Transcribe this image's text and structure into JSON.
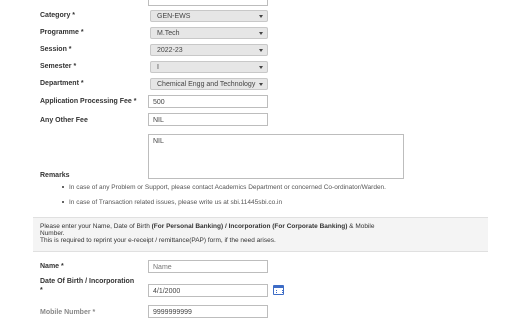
{
  "form": {
    "category": {
      "label": "Category *",
      "value": "GEN-EWS"
    },
    "programme": {
      "label": "Programme *",
      "value": "M.Tech"
    },
    "session": {
      "label": "Session *",
      "value": "2022-23"
    },
    "semester": {
      "label": "Semester *",
      "value": "I"
    },
    "department": {
      "label": "Department *",
      "value": "Chemical Engg and Technology"
    },
    "processing_fee": {
      "label": "Application Processing Fee *",
      "value": "500"
    },
    "other_fee": {
      "label": "Any Other Fee",
      "value": "NIL"
    },
    "remarks": {
      "label": "Remarks",
      "value": "NIL"
    }
  },
  "notes": [
    "In case of any Problem or Support, please contact Academics Department or concerned Co-ordinator/Warden.",
    "In case of Transaction related issues, please write us at sbi.11445sbi.co.in"
  ],
  "info": {
    "part1": "Please enter your Name, Date of Birth ",
    "bold1": "(For Personal Banking) / Incorporation (For Corporate Banking)",
    "part2": " & Mobile",
    "line2": "Number.",
    "line3": "This is required to reprint your e-receipt / remittance(PAP) form, if the need arises."
  },
  "identity": {
    "name": {
      "label": "Name *",
      "placeholder": "Name"
    },
    "dob": {
      "label_line1": "Date Of Birth / Incorporation",
      "label_line2": "*",
      "value": "4/1/2000",
      "icon": "calendar-icon"
    },
    "mobile": {
      "label": "Mobile Number *",
      "value": "9999999999"
    }
  },
  "colors": {
    "accent": "#3d6cc6",
    "select_bg": "#e6e6e6"
  }
}
